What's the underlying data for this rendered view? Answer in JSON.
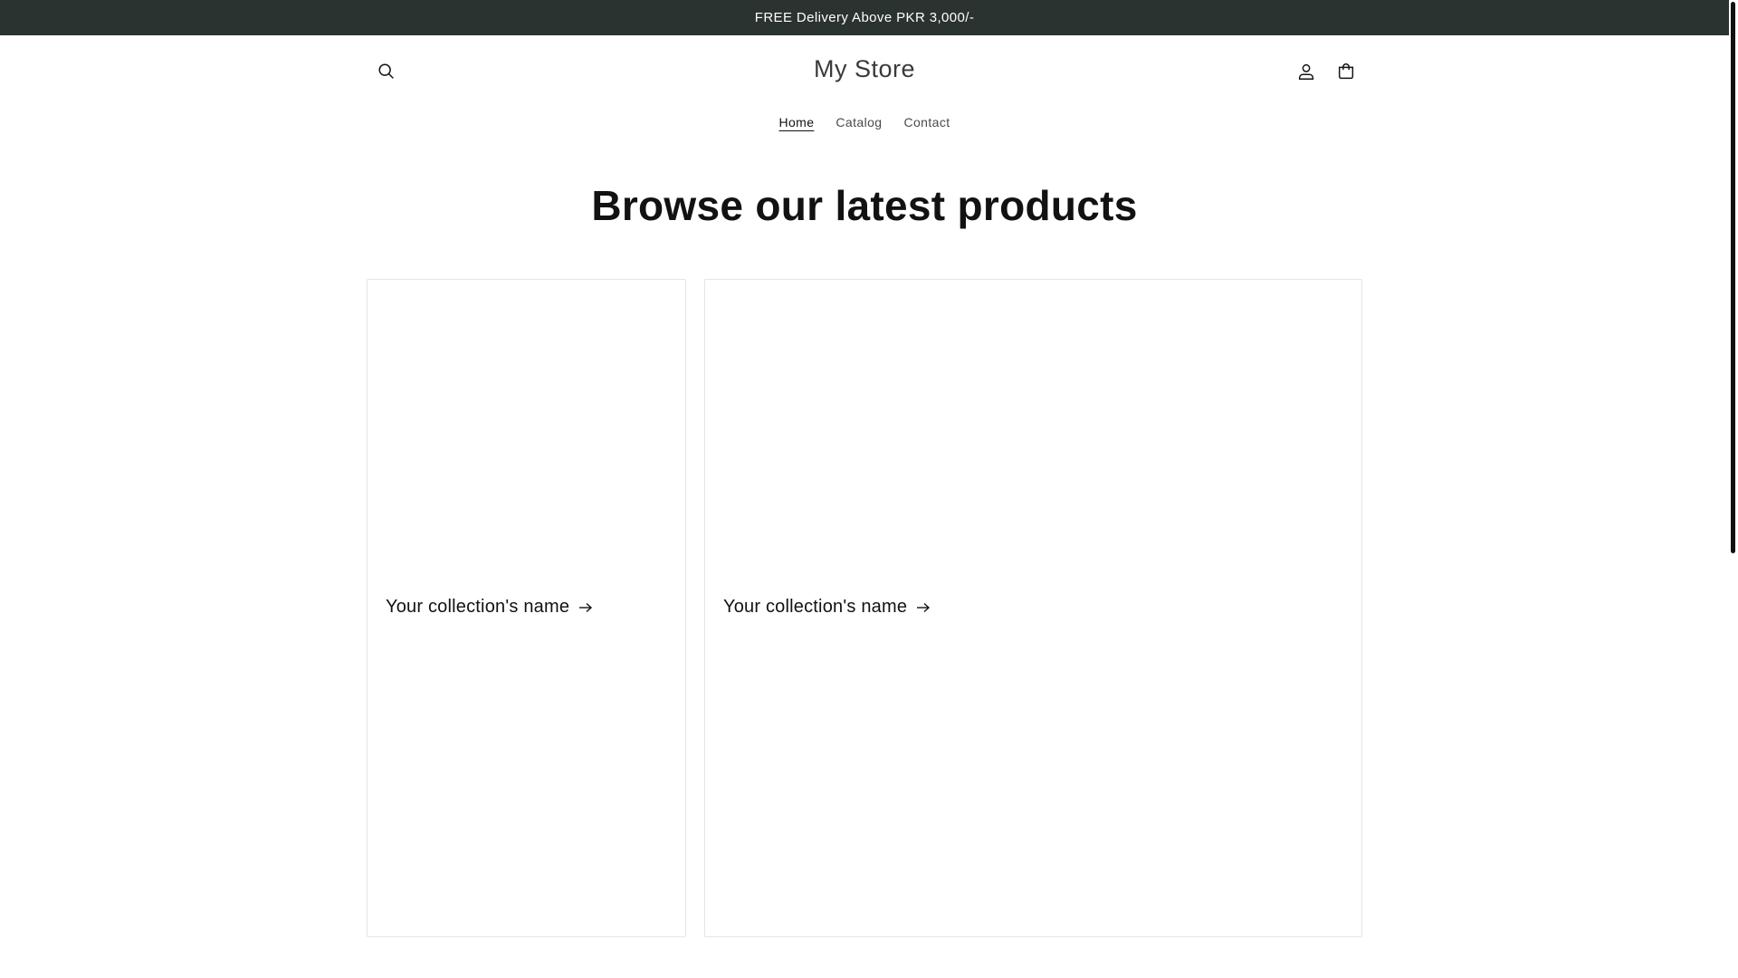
{
  "announcement": {
    "text": "FREE Delivery Above PKR 3,000/-"
  },
  "header": {
    "store_name": "My Store",
    "icons": {
      "search": "search-icon",
      "account": "account-icon",
      "cart": "cart-icon"
    }
  },
  "nav": {
    "items": [
      {
        "label": "Home",
        "active": true
      },
      {
        "label": "Catalog",
        "active": false
      },
      {
        "label": "Contact",
        "active": false
      }
    ]
  },
  "main": {
    "title": "Browse our latest products",
    "collections": [
      {
        "name": "Your collection's name"
      },
      {
        "name": "Your collection's name"
      }
    ]
  },
  "colors": {
    "announcement_bg": "#2b3331",
    "text": "#121212",
    "card_border": "#e4e4e4"
  }
}
